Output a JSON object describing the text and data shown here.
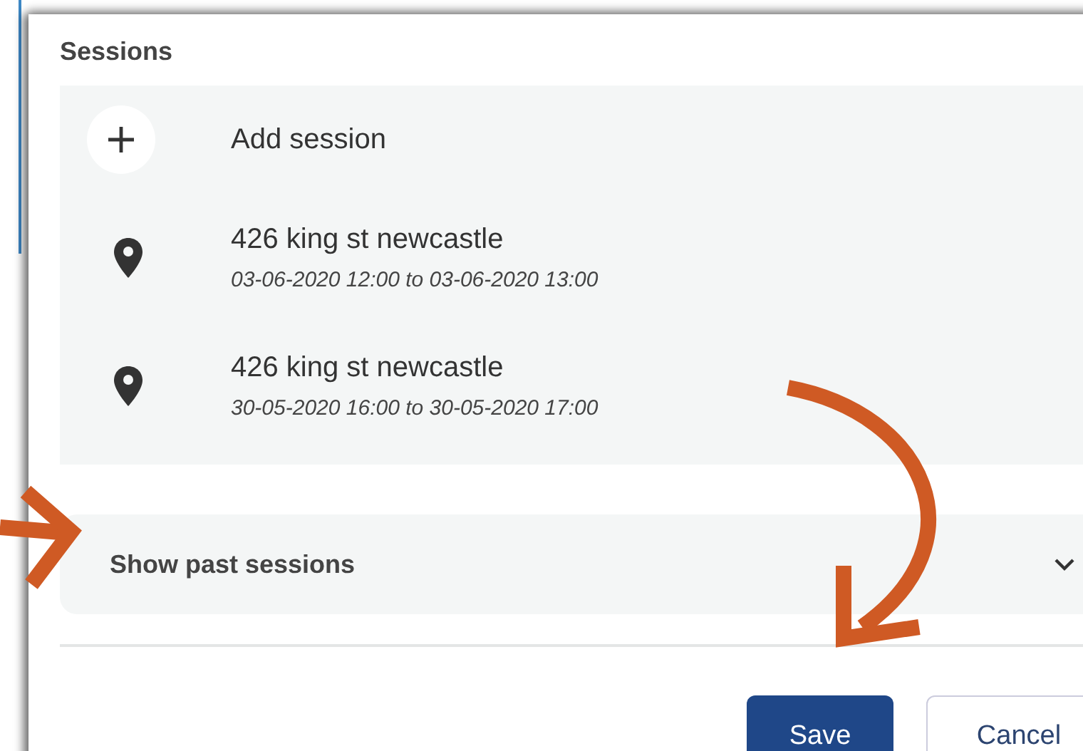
{
  "section_title": "Sessions",
  "add_action": {
    "label": "Add session"
  },
  "sessions": [
    {
      "location": "426 king st newcastle",
      "time": "03-06-2020 12:00 to 03-06-2020 13:00"
    },
    {
      "location": "426 king st newcastle",
      "time": "30-05-2020 16:00 to 30-05-2020 17:00"
    }
  ],
  "past_sessions": {
    "label": "Show past sessions",
    "expanded": false
  },
  "buttons": [
    {
      "label": "Save",
      "kind": "primary"
    },
    {
      "label": "Cancel",
      "kind": "secondary"
    }
  ]
}
